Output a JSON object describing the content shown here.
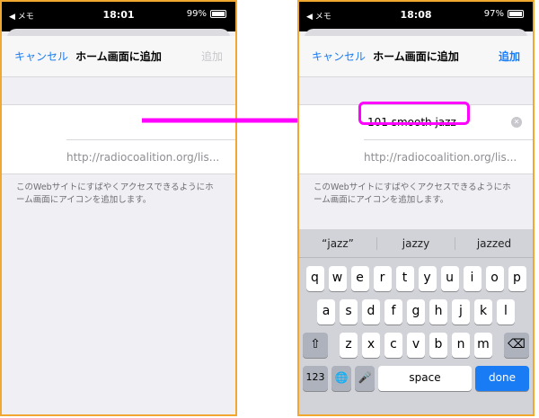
{
  "left": {
    "status": {
      "left": "◀ メモ",
      "time": "18:01",
      "battery": "99%"
    },
    "nav": {
      "cancel": "キャンセル",
      "title": "ホーム画面に追加",
      "add": "追加"
    },
    "name_value": "",
    "url": "http://radiocoalition.org/lis...",
    "note": "このWebサイトにすばやくアクセスできるようにホーム画面にアイコンを追加します。"
  },
  "right": {
    "status": {
      "left": "◀ メモ",
      "time": "18:08",
      "battery": "97%"
    },
    "nav": {
      "cancel": "キャンセル",
      "title": "ホーム画面に追加",
      "add": "追加"
    },
    "name_value": "101 smooth jazz",
    "url": "http://radiocoalition.org/lis...",
    "note": "このWebサイトにすばやくアクセスできるようにホーム画面にアイコンを追加します。",
    "keyboard": {
      "suggestions": [
        "“jazz”",
        "jazzy",
        "jazzed"
      ],
      "row1": [
        "q",
        "w",
        "e",
        "r",
        "t",
        "y",
        "u",
        "i",
        "o",
        "p"
      ],
      "row2": [
        "a",
        "s",
        "d",
        "f",
        "g",
        "h",
        "j",
        "k",
        "l"
      ],
      "row3": [
        "z",
        "x",
        "c",
        "v",
        "b",
        "n",
        "m"
      ],
      "shift": "⇧",
      "delete": "⌫",
      "numbers": "123",
      "globe": "🌐",
      "mic": "🎤",
      "space": "space",
      "done": "done"
    }
  },
  "colors": {
    "accent": "#1a7cf4",
    "highlight": "#ff00ff",
    "frame": "#f0a830"
  }
}
